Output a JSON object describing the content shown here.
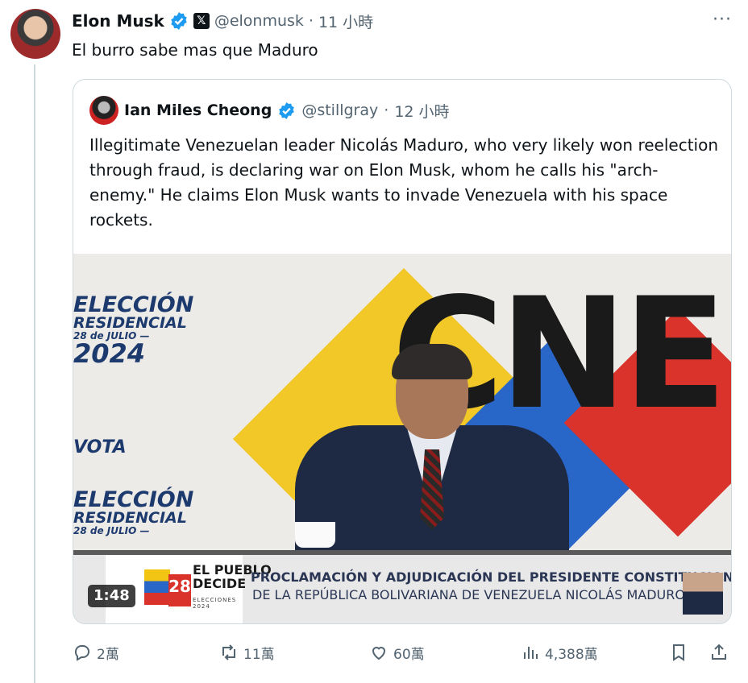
{
  "tweet": {
    "author_name": "Elon Musk",
    "handle": "@elonmusk",
    "separator": "·",
    "time": "11 小時",
    "text": "El burro sabe mas que Maduro",
    "more": "···"
  },
  "quote": {
    "author_name": "Ian Miles Cheong",
    "handle": "@stillgray",
    "separator": "·",
    "time": "12 小時",
    "text": "Illegitimate Venezuelan leader Nicolás Maduro, who very likely won reelection through fraud, is declaring war on Elon Musk, whom he calls his \"arch-enemy.\" He claims Elon Musk wants to invade Venezuela with his space rockets."
  },
  "video": {
    "duration": "1:48",
    "backdrop_logo": "CNE",
    "eleccion_line1": "ELECCIÓN",
    "eleccion_line2": "RESIDENCIAL",
    "eleccion_date": "28 de JULIO —",
    "eleccion_year": "2024",
    "vota": "VOTA",
    "banner_brand_line1": "EL PUEBLO",
    "banner_brand_line2": "DECIDE",
    "banner_brand_sub": "ELECCIONES 2024",
    "banner_number": "28",
    "banner_line1": "PROCLAMACIÓN Y ADJUDICACIÓN DEL PRESIDENTE CONSTITUCIONAL",
    "banner_line2": "DE LA REPÚBLICA BOLIVARIANA DE VENEZUELA NICOLÁS MADURO"
  },
  "actions": {
    "replies": "2萬",
    "reposts": "11萬",
    "likes": "60萬",
    "views": "4,388萬"
  },
  "colors": {
    "text": "#0f1419",
    "secondary": "#536471",
    "border": "#cfd9de",
    "verified": "#1d9bf0"
  }
}
